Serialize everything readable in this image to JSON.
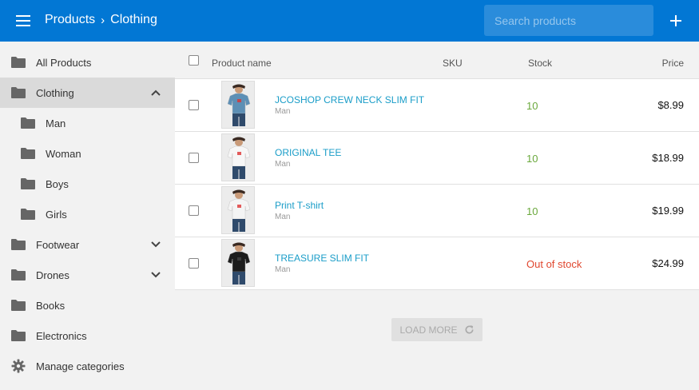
{
  "header": {
    "breadcrumb_root": "Products",
    "breadcrumb_separator": "›",
    "breadcrumb_current": "Clothing",
    "search_placeholder": "Search products",
    "color": "#0277d4"
  },
  "sidebar": {
    "items": [
      {
        "label": "All Products",
        "icon": "folder-icon",
        "level": 0
      },
      {
        "label": "Clothing",
        "icon": "folder-icon",
        "level": 0,
        "active": true,
        "expanded": true
      },
      {
        "label": "Man",
        "icon": "folder-icon",
        "level": 1
      },
      {
        "label": "Woman",
        "icon": "folder-icon",
        "level": 1
      },
      {
        "label": "Boys",
        "icon": "folder-icon",
        "level": 1
      },
      {
        "label": "Girls",
        "icon": "folder-icon",
        "level": 1
      },
      {
        "label": "Footwear",
        "icon": "folder-icon",
        "level": 0,
        "collapsible": true
      },
      {
        "label": "Drones",
        "icon": "folder-icon",
        "level": 0,
        "collapsible": true
      },
      {
        "label": "Books",
        "icon": "folder-icon",
        "level": 0
      },
      {
        "label": "Electronics",
        "icon": "folder-icon",
        "level": 0
      },
      {
        "label": "Manage categories",
        "icon": "gear-icon",
        "level": 0
      }
    ]
  },
  "table": {
    "columns": {
      "name": "Product name",
      "sku": "SKU",
      "stock": "Stock",
      "price": "Price"
    },
    "rows": [
      {
        "name": "JCOSHOP CREW NECK SLIM FIT",
        "category": "Man",
        "stock": "10",
        "in_stock": true,
        "price": "$8.99",
        "shirt_color": "#5d8fb5"
      },
      {
        "name": "ORIGINAL TEE",
        "category": "Man",
        "stock": "10",
        "in_stock": true,
        "price": "$18.99",
        "shirt_color": "#f7f7f7"
      },
      {
        "name": "Print T-shirt",
        "category": "Man",
        "stock": "10",
        "in_stock": true,
        "price": "$19.99",
        "shirt_color": "#f4f4f4"
      },
      {
        "name": "TREASURE SLIM FIT",
        "category": "Man",
        "stock": "Out of stock",
        "in_stock": false,
        "price": "$24.99",
        "shirt_color": "#1c1c1c"
      }
    ]
  },
  "load_more_label": "LOAD MORE",
  "colors": {
    "link": "#1a9dc8",
    "in_stock": "#6aa83c",
    "out_of_stock": "#e0472f",
    "active_nav": "#dadada"
  }
}
